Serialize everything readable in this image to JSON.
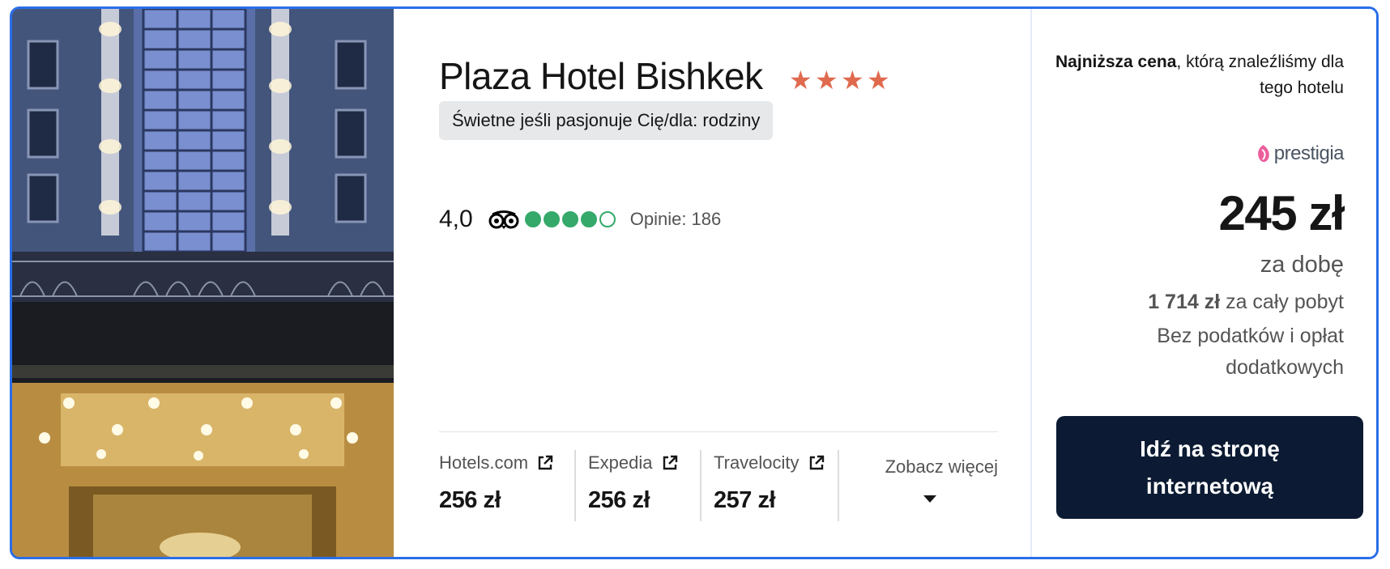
{
  "hotel": {
    "name": "Plaza Hotel Bishkek",
    "star_count": 4,
    "badge": "Świetne jeśli pasjonuje Cię/dla: rodziny",
    "rating_score": "4,0",
    "rating_bubbles": 4,
    "rating_bubbles_max": 5,
    "reviews": "Opinie: 186"
  },
  "providers": [
    {
      "name": "Hotels.com",
      "price": "256 zł"
    },
    {
      "name": "Expedia",
      "price": "256 zł"
    },
    {
      "name": "Travelocity",
      "price": "257 zł"
    }
  ],
  "see_more": "Zobacz więcej",
  "price_panel": {
    "lowest_bold": "Najniższa cena",
    "lowest_rest": ", którą znaleźliśmy dla tego hotelu",
    "partner": "prestigia",
    "price": "245 zł",
    "per_night": "za dobę",
    "total_amount": "1 714 zł",
    "total_label": " za cały pobyt",
    "taxes": "Bez podatków i opłat dodatkowych",
    "cta": "Idź na stronę internetową"
  },
  "colors": {
    "card_border": "#2a6ee8",
    "star": "#e06a4e",
    "bubble": "#34a96a",
    "cta_bg": "#0c1b33",
    "badge_bg": "#e6e8ea"
  },
  "icons": {
    "star": "star-icon",
    "tripadvisor": "tripadvisor-owl-icon",
    "external": "external-link-icon",
    "caret": "caret-down-icon"
  }
}
